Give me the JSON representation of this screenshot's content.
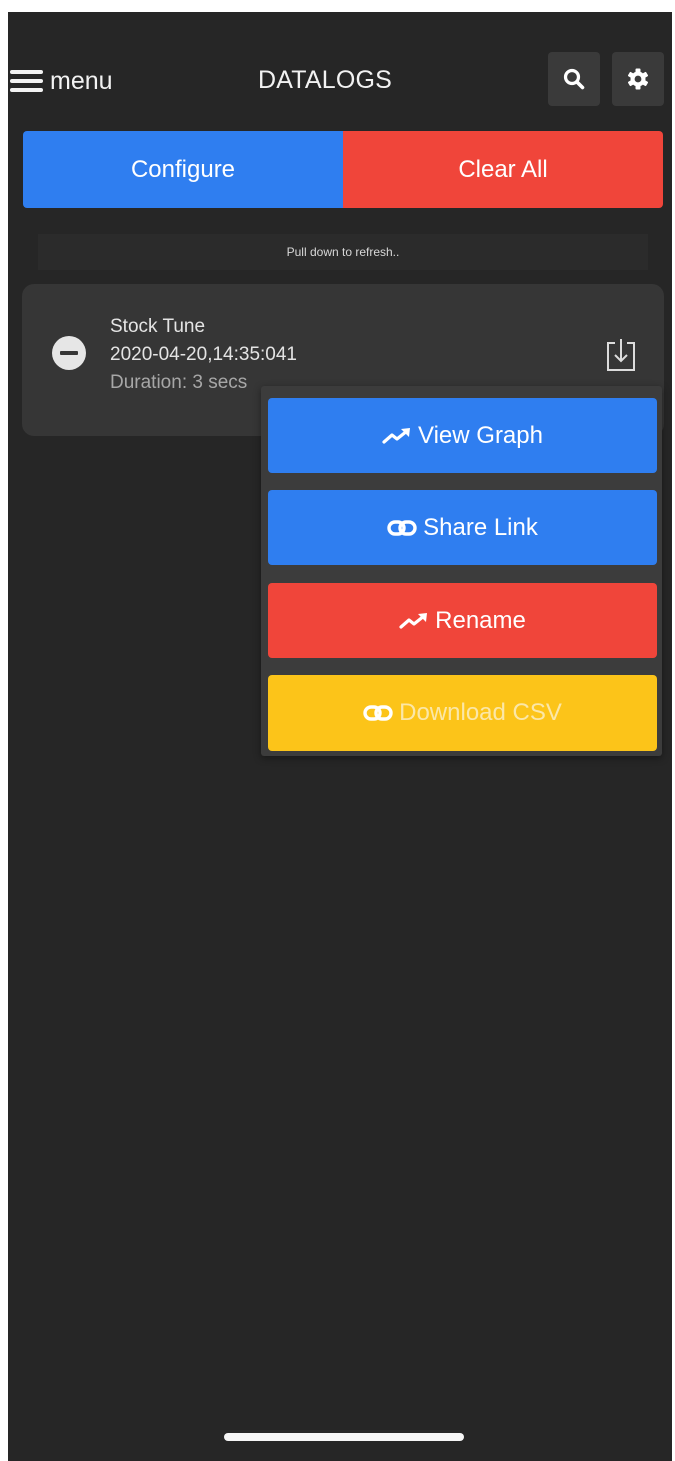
{
  "header": {
    "menu_label": "menu",
    "title": "DATALOGS",
    "icons": {
      "search": "search-icon",
      "settings": "gear-icon",
      "menu": "hamburger-icon"
    }
  },
  "actions": {
    "configure_label": "Configure",
    "clear_all_label": "Clear All"
  },
  "refresh_hint": "Pull down to refresh..",
  "log_item": {
    "name": "Stock Tune",
    "datetime": "2020-04-20,14:35:041",
    "duration": "Duration: 3 secs"
  },
  "popup_menu": {
    "items": [
      {
        "label": "View Graph",
        "icon": "trending-up-icon"
      },
      {
        "label": "Share Link",
        "icon": "link-icon"
      },
      {
        "label": "Rename",
        "icon": "trending-up-icon"
      },
      {
        "label": "Download CSV",
        "icon": "link-icon"
      }
    ]
  },
  "colors": {
    "background": "#262626",
    "primary": "#2f7ef0",
    "danger": "#f0453a",
    "warning": "#fcc419",
    "card": "#363636"
  }
}
